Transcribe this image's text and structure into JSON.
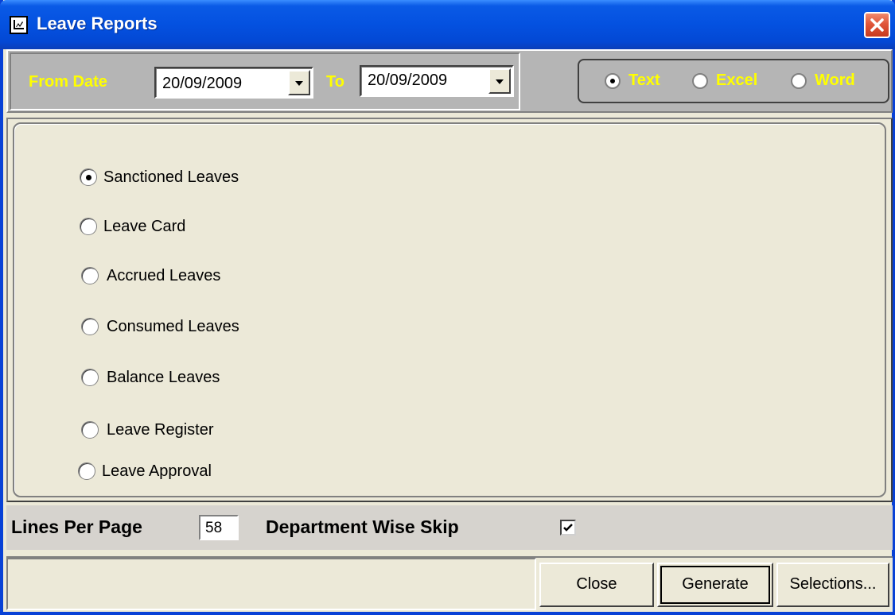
{
  "window": {
    "title": "Leave Reports",
    "icon": "report-window-icon"
  },
  "top": {
    "from_label": "From Date",
    "from_value": "20/09/2009",
    "to_label": "To",
    "to_value": "20/09/2009",
    "formats": [
      {
        "label": "Text",
        "selected": true
      },
      {
        "label": "Excel",
        "selected": false
      },
      {
        "label": "Word",
        "selected": false
      }
    ]
  },
  "options": [
    {
      "label": "Sanctioned Leaves",
      "selected": true
    },
    {
      "label": "Leave Card",
      "selected": false
    },
    {
      "label": "Accrued Leaves",
      "selected": false
    },
    {
      "label": "Consumed Leaves",
      "selected": false
    },
    {
      "label": "Balance Leaves",
      "selected": false
    },
    {
      "label": "Leave Register",
      "selected": false
    },
    {
      "label": "Leave Approval",
      "selected": false
    }
  ],
  "footer_options": {
    "lines_label": "Lines Per Page",
    "lines_value": "58",
    "dept_label": "Department Wise Skip",
    "dept_checked": true
  },
  "buttons": {
    "close": "Close",
    "generate": "Generate",
    "selections": "Selections..."
  },
  "colors": {
    "titlebar": "#0451e0",
    "accent_label": "#ffff00",
    "panel_gray": "#b5b5b5",
    "face": "#ece9d8"
  }
}
